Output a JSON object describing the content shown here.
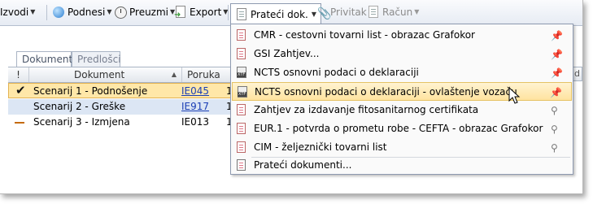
{
  "toolbar": {
    "items": [
      {
        "label": "Izvodi",
        "icon": "document-icon"
      },
      {
        "label": "Podnesi",
        "icon": "globe-icon"
      },
      {
        "label": "Preuzmi",
        "icon": "clock-icon"
      },
      {
        "label": "Export",
        "icon": "export-icon"
      },
      {
        "label": "Prateći dok.",
        "icon": "document-icon",
        "active": true
      },
      {
        "label": "Privitak",
        "icon": "paperclip-icon",
        "disabled": true
      },
      {
        "label": "Račun",
        "icon": "document-icon",
        "disabled": true
      }
    ]
  },
  "tabs": [
    {
      "label": "Dokumenti",
      "selected": true
    },
    {
      "label": "Predlošci",
      "selected": false
    }
  ],
  "grid": {
    "columns": [
      "!",
      "Dokument",
      "Poruka"
    ],
    "right_partial_header": "d",
    "rows": [
      {
        "document": "Scenarij 1 - Podnošenje",
        "message": "IE045",
        "trail": "1",
        "status": "check",
        "message_link": true
      },
      {
        "document": "Scenarij 2 - Greške",
        "message": "IE917",
        "trail": "1",
        "status": "none",
        "message_link": true
      },
      {
        "document": "Scenarij 3 - Izmjena",
        "message": "IE013",
        "trail": "1",
        "status": "dash",
        "message_link": false
      }
    ]
  },
  "menu": {
    "items": [
      {
        "label": "CMR - cestovni tovarni list - obrazac Grafokor",
        "icon": "pdf-document-icon",
        "pinned": true
      },
      {
        "label": "GSI Zahtjev...",
        "icon": "pdf-document-icon",
        "pinned": true
      },
      {
        "label": "NCTS osnovni podaci o deklaraciji",
        "icon": "xtf-document-icon",
        "pinned": true
      },
      {
        "label": "NCTS osnovni podaci o deklaraciji - ovlaštenje vozaču",
        "icon": "xtf-document-icon",
        "pinned": true,
        "hover": true
      },
      {
        "label": "Zahtjev za izdavanje fitosanitarnog certifikata",
        "icon": "pdf-document-icon",
        "pinned": false
      },
      {
        "label": "EUR.1 - potvrda o prometu robe - CEFTA - obrazac Grafokor",
        "icon": "pdf-document-icon",
        "pinned": false
      },
      {
        "label": "CIM - željeznički tovarni list",
        "icon": "pdf-document-icon",
        "pinned": false
      }
    ],
    "footer_item": {
      "label": "Prateći dokumenti...",
      "icon": "documents-icon"
    }
  },
  "colors": {
    "selection_row": "#ffe7a8",
    "secondary_row": "#dce6f4",
    "hover_item": "#ffe39f",
    "link": "#1a3eb5",
    "pin_active": "#1f5fd1"
  }
}
